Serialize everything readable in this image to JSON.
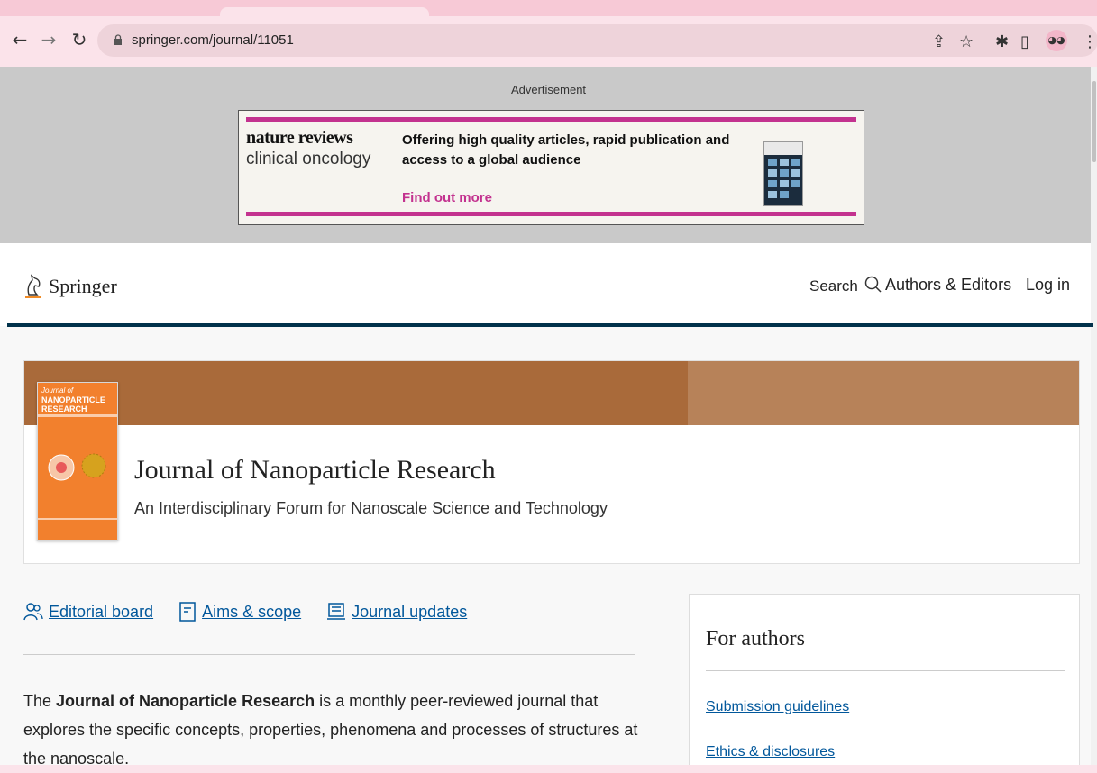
{
  "browser": {
    "url": "springer.com/journal/11051",
    "icons": [
      "back-icon",
      "forward-icon",
      "reload-icon",
      "lock-icon",
      "share-icon",
      "bookmark-star-icon",
      "extensions-icon",
      "side-panel-icon",
      "profile-icon",
      "menu-icon"
    ]
  },
  "ad": {
    "label": "Advertisement",
    "brand_line1": "nature reviews",
    "brand_line2": "clinical oncology",
    "text": "Offering high quality articles, rapid publication and access to a global audience",
    "link": "Find out more",
    "accent_color": "#c3328f"
  },
  "header": {
    "logo_text": "Springer",
    "search_label": "Search",
    "authors_editors_label": "Authors & Editors",
    "login_label": "Log in"
  },
  "journal": {
    "title": "Journal of Nanoparticle Research",
    "subtitle": "An Interdisciplinary Forum for Nanoscale Science and Technology",
    "cover_title_line1": "Journal of",
    "cover_title_line2": "NANOPARTICLE",
    "cover_title_line3": "RESEARCH",
    "band_color": "#a96a3a"
  },
  "links": {
    "editorial_board": "Editorial board",
    "aims_scope": "Aims & scope",
    "journal_updates": "Journal updates"
  },
  "description": {
    "prefix": "The ",
    "bold": "Journal of Nanoparticle Research",
    "suffix": " is a monthly peer-reviewed journal that explores the specific concepts, properties, phenomena and processes of structures at the nanoscale."
  },
  "for_authors": {
    "title": "For authors",
    "items": [
      "Submission guidelines",
      "Ethics & disclosures"
    ]
  }
}
